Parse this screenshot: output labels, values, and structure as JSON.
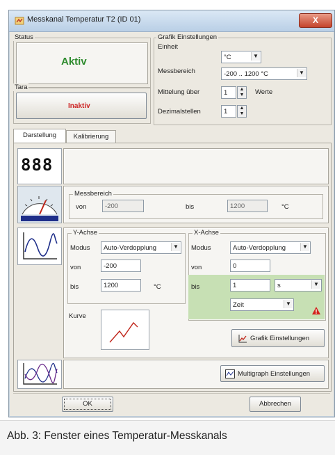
{
  "window": {
    "title": "Messkanal Temperatur T2 (ID 01)",
    "close_label": "X"
  },
  "status": {
    "group_title": "Status",
    "value": "Aktiv"
  },
  "tara": {
    "group_title": "Tara",
    "value": "Inaktiv"
  },
  "grafik": {
    "group_title": "Grafik Einstellungen",
    "einheit_label": "Einheit",
    "einheit_value": "°C",
    "messbereich_label": "Messbereich",
    "messbereich_value": "-200 .. 1200 °C",
    "mittelung_label": "Mittelung über",
    "mittelung_value": "1",
    "mittelung_unit": "Werte",
    "dezimal_label": "Dezimalstellen",
    "dezimal_value": "1"
  },
  "tabs": [
    {
      "label": "Darstellung"
    },
    {
      "label": "Kalibrierung"
    }
  ],
  "display": {
    "digital_icon": "888"
  },
  "messbereich": {
    "group_title": "Messbereich",
    "von_label": "von",
    "von_value": "-200",
    "bis_label": "bis",
    "bis_value": "1200",
    "unit": "°C"
  },
  "yachse": {
    "group_title": "Y-Achse",
    "modus_label": "Modus",
    "modus_value": "Auto-Verdopplung",
    "von_label": "von",
    "von_value": "-200",
    "bis_label": "bis",
    "bis_value": "1200",
    "unit": "°C",
    "kurve_label": "Kurve"
  },
  "xachse": {
    "group_title": "X-Achse",
    "modus_label": "Modus",
    "modus_value": "Auto-Verdopplung",
    "von_label": "von",
    "von_value": "0",
    "bis_label": "bis",
    "bis_value": "1",
    "bis_unit": "s",
    "zeit_value": "Zeit"
  },
  "buttons": {
    "grafik": "Grafik Einstellungen",
    "multigraph": "Multigraph Einstellungen",
    "ok": "OK",
    "cancel": "Abbrechen"
  },
  "caption": "Abb. 3: Fenster eines Temperatur-Messkanals",
  "colors": {
    "active_green": "#2e8b2e",
    "inactive_red": "#cc2222",
    "xaxis_bg": "#c7e0b4"
  }
}
